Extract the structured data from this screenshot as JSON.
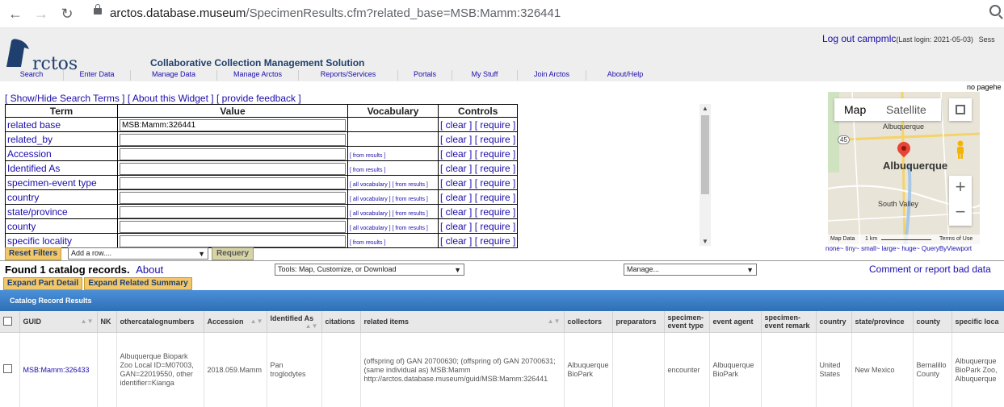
{
  "browser": {
    "url_host": "arctos.database.museum",
    "url_path": "/SpecimenResults.cfm?related_base=MSB:Mamm:326441"
  },
  "header": {
    "logo_text": "rctos",
    "tagline": "Collaborative Collection Management Solution",
    "logout_label": "Log out campmlc",
    "last_login": "(Last login: 2021-05-03)",
    "session_cut": "Sess",
    "menu": [
      "Search",
      "Enter Data",
      "Manage Data",
      "Manage Arctos",
      "Reports/Services",
      "Portals",
      "My Stuff",
      "Join Arctos",
      "About/Help"
    ]
  },
  "search": {
    "nopage": "no pagehe",
    "links": [
      "[ Show/Hide Search Terms ]",
      "[ About this Widget ]",
      "[ provide feedback ]"
    ],
    "columns": [
      "Term",
      "Value",
      "Vocabulary",
      "Controls"
    ],
    "clear_label": "[ clear ]",
    "require_label": "[ require ]",
    "rows": [
      {
        "term": "related base",
        "value": "MSB:Mamm:326441",
        "vocab": ""
      },
      {
        "term": "related_by",
        "value": "",
        "vocab": ""
      },
      {
        "term": "Accession",
        "value": "",
        "vocab": "[ from results ]"
      },
      {
        "term": "Identified As",
        "value": "",
        "vocab": "[ from results ]"
      },
      {
        "term": "specimen-event type",
        "value": "",
        "vocab": "[ all vocabulary ] [ from results ]"
      },
      {
        "term": "country",
        "value": "",
        "vocab": "[ all vocabulary ] [ from results ]"
      },
      {
        "term": "state/province",
        "value": "",
        "vocab": "[ all vocabulary ] [ from results ]"
      },
      {
        "term": "county",
        "value": "",
        "vocab": "[ all vocabulary ] [ from results ]"
      },
      {
        "term": "specific locality",
        "value": "",
        "vocab": "[ from results ]"
      }
    ],
    "reset_label": "Reset Filters",
    "add_row_placeholder": "Add a row....",
    "requery_label": "Requery"
  },
  "map": {
    "tab_map": "Map",
    "tab_satellite": "Satellite",
    "city": "Albuquerque",
    "city_small": "Albuquerque",
    "south_valley": "South Valley",
    "highway": "45",
    "footer_data": "Map Data",
    "footer_scale": "1 km",
    "footer_terms": "Terms of Use",
    "size_links": [
      "none",
      "tiny",
      "small",
      "large",
      "huge",
      "QueryByViewport"
    ]
  },
  "results": {
    "found_text": "Found 1 catalog records.",
    "about_label": "About",
    "tools_select": "Tools: Map, Customize, or Download",
    "manage_select": "Manage...",
    "comment_link": "Comment or report bad data",
    "expand_part": "Expand Part Detail",
    "expand_related": "Expand Related Summary",
    "header_title": "Catalog Record Results",
    "columns": [
      "GUID",
      "NK",
      "othercatalognumbers",
      "Accession",
      "Identified As",
      "citations",
      "related items",
      "collectors",
      "preparators",
      "specimen-event type",
      "event agent",
      "specimen-event remark",
      "country",
      "state/province",
      "county",
      "specific loca"
    ],
    "row": {
      "guid": "MSB:Mamm:326433",
      "nk": "",
      "othercatalognumbers": "Albuquerque Biopark Zoo Local ID=M07003, GAN=22019550, other identifier=Kianga",
      "accession": "2018.059.Mamm",
      "identified_as": "Pan troglodytes",
      "citations": "",
      "related_items": "(offspring of) GAN 20700630; (offspring of) GAN 20700631; (same individual as) MSB:Mamm http://arctos.database.museum/guid/MSB:Mamm:326441",
      "collectors": "Albuquerque BioPark",
      "preparators": "",
      "event_type": "encounter",
      "event_agent": "Albuquerque BioPark",
      "event_remark": "",
      "country": "United States",
      "state": "New Mexico",
      "county": "Bernalillo County",
      "locality": "Albuquerque BioPark Zoo, Albuquerque"
    }
  }
}
